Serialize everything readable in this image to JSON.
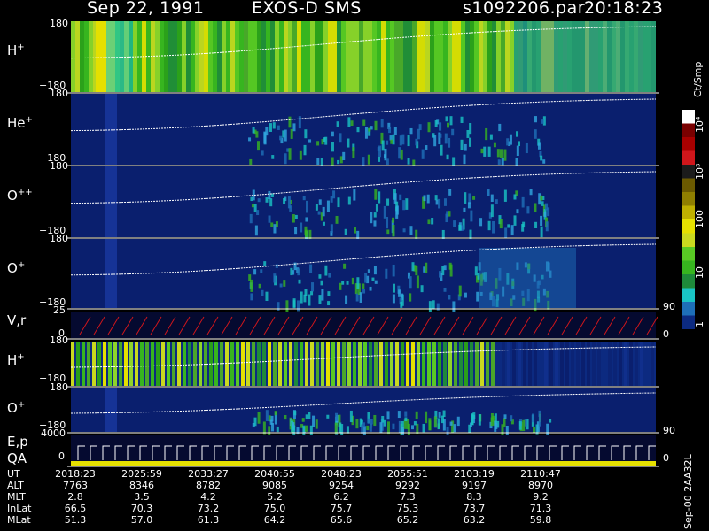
{
  "header": {
    "date": "Sep 22, 1991",
    "instrument": "EXOS-D SMS",
    "file": "s1092206.par",
    "time": "20:18:23"
  },
  "panels": [
    {
      "id": "h1",
      "label": "H",
      "sup": "+",
      "top_tick": "180",
      "bottom_tick": "−180",
      "palette": "green"
    },
    {
      "id": "he",
      "label": "He",
      "sup": "+",
      "top_tick": "180",
      "bottom_tick": "−180",
      "palette": "blue"
    },
    {
      "id": "opp",
      "label": "O",
      "sup": "++",
      "top_tick": "180",
      "bottom_tick": "−180",
      "palette": "blue"
    },
    {
      "id": "op1",
      "label": "O",
      "sup": "+",
      "top_tick": "180",
      "bottom_tick": "−180",
      "palette": "blue",
      "right_tick": "90"
    },
    {
      "id": "vr",
      "label": "V,r",
      "sup": "",
      "top_tick": "25",
      "bottom_tick": "0",
      "right_tick": "0",
      "palette": "dark"
    },
    {
      "id": "h2",
      "label": "H",
      "sup": "+",
      "top_tick": "180",
      "bottom_tick": "−180",
      "palette": "stripes"
    },
    {
      "id": "op2",
      "label": "O",
      "sup": "+",
      "top_tick": "180",
      "bottom_tick": "−180",
      "right_tick": "90",
      "palette": "blue"
    },
    {
      "id": "ep",
      "label": "E,p",
      "label2": "QA",
      "top_tick": "4000",
      "bottom_tick": "0",
      "right_tick": "0",
      "palette": "dark"
    }
  ],
  "colorbar": {
    "unit": "Ct/Smp",
    "labels": [
      "10⁴",
      "10³",
      "100",
      "10",
      "1"
    ]
  },
  "footer": {
    "labels": [
      "UT",
      "ALT",
      "MLT",
      "InLat",
      "MLat"
    ],
    "columns": [
      [
        "2018:23",
        "7763",
        "2.8",
        "66.5",
        "51.3"
      ],
      [
        "2025:59",
        "8346",
        "3.5",
        "70.3",
        "57.0"
      ],
      [
        "2033:27",
        "8782",
        "4.2",
        "73.2",
        "61.3"
      ],
      [
        "2040:55",
        "9085",
        "5.2",
        "75.0",
        "64.2"
      ],
      [
        "2048:23",
        "9254",
        "6.2",
        "75.7",
        "65.6"
      ],
      [
        "2055:51",
        "9292",
        "7.3",
        "75.3",
        "65.2"
      ],
      [
        "2103:19",
        "9197",
        "8.3",
        "73.7",
        "63.2"
      ],
      [
        "2110:47",
        "8970",
        "9.2",
        "71.3",
        "59.8"
      ]
    ],
    "side_text": "Sep-00  2AA32L"
  },
  "colors": {
    "deep_blue": "#0a1f6e",
    "green": "#37b51f",
    "yellow": "#e5e000",
    "cyan": "#19c4c4",
    "red": "#d0161b"
  }
}
